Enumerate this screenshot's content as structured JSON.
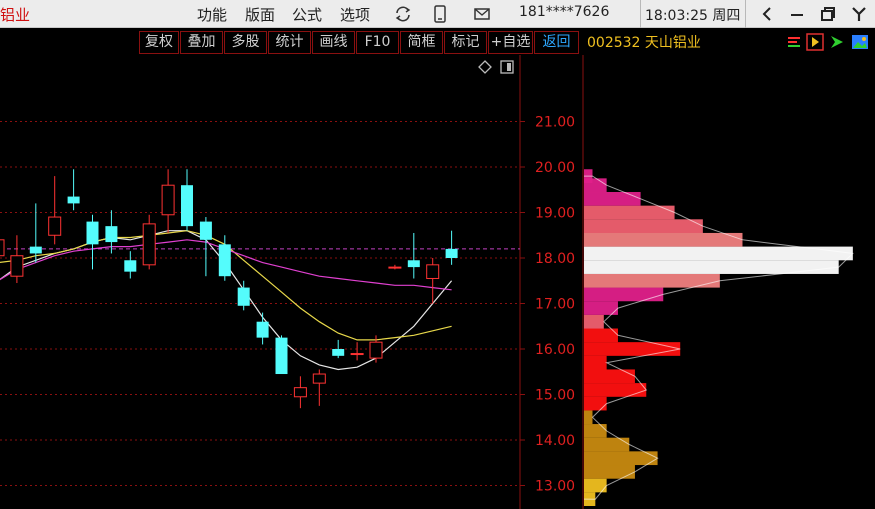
{
  "window": {
    "title": "铝业",
    "menu": [
      "功能",
      "版面",
      "公式",
      "选项"
    ],
    "account": "181****7626",
    "clock": "18:03:25 周四"
  },
  "toolbar": {
    "buttons": [
      "复权",
      "叠加",
      "多股",
      "统计",
      "画线",
      "F10",
      "简框",
      "标记",
      "+自选"
    ],
    "back_label": "返回",
    "stock_title": "002532 天山铝业"
  },
  "icons": {
    "sync": "sync-icon",
    "mobile": "mobile-icon",
    "message": "envelope-icon",
    "back": "chevron-left-icon",
    "minimize": "minimize-icon",
    "restore": "restore-icon",
    "close": "close-icon"
  },
  "colors": {
    "up": "#ff3333",
    "down": "#54fcfc",
    "ma_white": "#e6e6e6",
    "ma_yellow": "#e8d84a",
    "ma_magenta": "#e040d0",
    "price_line": "#c040c0",
    "grid": "#8a1010",
    "axis_label": "#e02020"
  },
  "chart_data": {
    "type": "candlestick",
    "y_axis": {
      "ticks": [
        "13.00",
        "14.00",
        "15.00",
        "16.00",
        "17.00",
        "18.00",
        "19.00",
        "20.00",
        "21.00"
      ],
      "range": [
        12.6,
        22.0
      ]
    },
    "current_price": 18.2,
    "candles": [
      {
        "o": 18.05,
        "h": 18.4,
        "l": 17.35,
        "c": 18.4
      },
      {
        "o": 17.6,
        "h": 18.5,
        "l": 17.45,
        "c": 18.05
      },
      {
        "o": 18.25,
        "h": 19.2,
        "l": 17.9,
        "c": 18.1
      },
      {
        "o": 18.5,
        "h": 19.8,
        "l": 18.3,
        "c": 18.9
      },
      {
        "o": 19.35,
        "h": 19.95,
        "l": 19.05,
        "c": 19.2
      },
      {
        "o": 18.8,
        "h": 18.95,
        "l": 17.75,
        "c": 18.3
      },
      {
        "o": 18.7,
        "h": 19.05,
        "l": 18.1,
        "c": 18.35
      },
      {
        "o": 17.95,
        "h": 18.15,
        "l": 17.55,
        "c": 17.7
      },
      {
        "o": 17.85,
        "h": 18.95,
        "l": 17.75,
        "c": 18.75
      },
      {
        "o": 18.95,
        "h": 19.95,
        "l": 18.55,
        "c": 19.6
      },
      {
        "o": 19.6,
        "h": 19.95,
        "l": 18.6,
        "c": 18.7
      },
      {
        "o": 18.8,
        "h": 18.9,
        "l": 17.6,
        "c": 18.4
      },
      {
        "o": 18.3,
        "h": 18.5,
        "l": 17.5,
        "c": 17.6
      },
      {
        "o": 17.35,
        "h": 17.5,
        "l": 16.85,
        "c": 16.95
      },
      {
        "o": 16.6,
        "h": 16.8,
        "l": 16.1,
        "c": 16.25
      },
      {
        "o": 16.25,
        "h": 16.3,
        "l": 15.45,
        "c": 15.45
      },
      {
        "o": 14.95,
        "h": 15.4,
        "l": 14.7,
        "c": 15.15
      },
      {
        "o": 15.25,
        "h": 15.55,
        "l": 14.75,
        "c": 15.45
      },
      {
        "o": 16.0,
        "h": 16.2,
        "l": 15.8,
        "c": 15.85
      },
      {
        "o": 15.9,
        "h": 16.15,
        "l": 15.75,
        "c": 15.9
      },
      {
        "o": 15.8,
        "h": 16.3,
        "l": 15.7,
        "c": 16.15
      },
      {
        "o": 17.8,
        "h": 17.85,
        "l": 17.75,
        "c": 17.8
      },
      {
        "o": 17.95,
        "h": 18.55,
        "l": 17.55,
        "c": 17.8
      },
      {
        "o": 17.55,
        "h": 18.0,
        "l": 17.0,
        "c": 17.85
      },
      {
        "o": 18.2,
        "h": 18.6,
        "l": 17.85,
        "c": 18.0
      }
    ],
    "ma_series": [
      {
        "color": "white",
        "values": [
          17.5,
          17.8,
          17.95,
          18.1,
          18.2,
          18.35,
          18.45,
          18.4,
          18.5,
          18.6,
          18.6,
          18.4,
          17.9,
          17.3,
          16.7,
          16.2,
          15.85,
          15.65,
          15.55,
          15.6,
          15.8,
          16.15,
          16.5,
          17.0,
          17.5
        ]
      },
      {
        "color": "yellow",
        "values": [
          17.9,
          17.95,
          18.05,
          18.1,
          18.2,
          18.35,
          18.45,
          18.45,
          18.5,
          18.55,
          18.6,
          18.5,
          18.3,
          17.95,
          17.6,
          17.25,
          16.9,
          16.6,
          16.35,
          16.2,
          16.2,
          16.25,
          16.3,
          16.4,
          16.5
        ]
      },
      {
        "color": "magenta",
        "values": [
          17.5,
          17.75,
          17.9,
          18.05,
          18.15,
          18.2,
          18.25,
          18.25,
          18.3,
          18.35,
          18.4,
          18.35,
          18.2,
          18.05,
          17.9,
          17.8,
          17.7,
          17.6,
          17.55,
          17.5,
          17.45,
          17.4,
          17.4,
          17.35,
          17.3
        ]
      }
    ],
    "volume_profile": {
      "bins": [
        {
          "price": 12.7,
          "depth": 0.04,
          "color": "#f0c020"
        },
        {
          "price": 13.0,
          "depth": 0.08,
          "color": "#f0c020"
        },
        {
          "price": 13.3,
          "depth": 0.18,
          "color": "#c88a10"
        },
        {
          "price": 13.6,
          "depth": 0.26,
          "color": "#c88a10"
        },
        {
          "price": 13.9,
          "depth": 0.16,
          "color": "#c88a10"
        },
        {
          "price": 14.2,
          "depth": 0.08,
          "color": "#c88a10"
        },
        {
          "price": 14.5,
          "depth": 0.03,
          "color": "#c88a10"
        },
        {
          "price": 14.8,
          "depth": 0.08,
          "color": "#ff1010"
        },
        {
          "price": 15.1,
          "depth": 0.22,
          "color": "#ff1010"
        },
        {
          "price": 15.4,
          "depth": 0.18,
          "color": "#ff1010"
        },
        {
          "price": 15.7,
          "depth": 0.08,
          "color": "#ff1010"
        },
        {
          "price": 16.0,
          "depth": 0.34,
          "color": "#ff1010"
        },
        {
          "price": 16.3,
          "depth": 0.12,
          "color": "#ff1010"
        },
        {
          "price": 16.6,
          "depth": 0.07,
          "color": "#f06070"
        },
        {
          "price": 16.9,
          "depth": 0.12,
          "color": "#e0208a"
        },
        {
          "price": 17.2,
          "depth": 0.28,
          "color": "#e0208a"
        },
        {
          "price": 17.5,
          "depth": 0.48,
          "color": "#f08080"
        },
        {
          "price": 17.8,
          "depth": 0.9,
          "color": "#ffffff"
        },
        {
          "price": 18.1,
          "depth": 0.95,
          "color": "#ffffff"
        },
        {
          "price": 18.4,
          "depth": 0.56,
          "color": "#f08080"
        },
        {
          "price": 18.7,
          "depth": 0.42,
          "color": "#f06070"
        },
        {
          "price": 19.0,
          "depth": 0.32,
          "color": "#f06070"
        },
        {
          "price": 19.3,
          "depth": 0.2,
          "color": "#e0208a"
        },
        {
          "price": 19.6,
          "depth": 0.08,
          "color": "#e0208a"
        },
        {
          "price": 19.8,
          "depth": 0.03,
          "color": "#e0208a"
        }
      ]
    }
  }
}
